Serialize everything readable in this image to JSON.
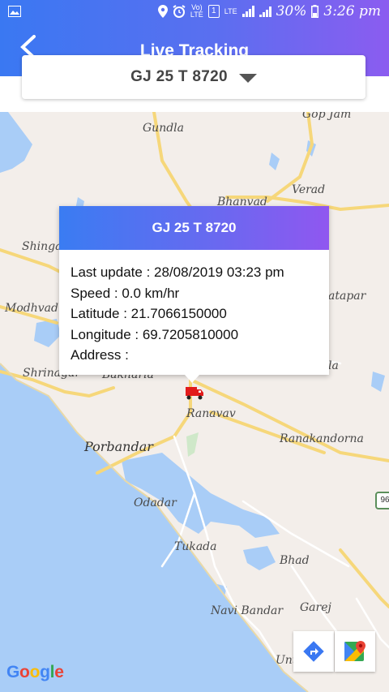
{
  "status_bar": {
    "lte_top": "Vo)",
    "lte_bottom": "LTE",
    "sim": "1",
    "lte2": "LTE",
    "battery": "30%",
    "time": "3:26 pm"
  },
  "header": {
    "title": "Live Tracking",
    "back_icon": "back-arrow-icon"
  },
  "vehicle_select": {
    "selected": "GJ 25 T 8720"
  },
  "popup": {
    "title": "GJ 25 T 8720",
    "last_update": "Last update : 28/08/2019 03:23 pm",
    "speed": "Speed : 0.0 km/hr",
    "latitude": "Latitude : 21.7066150000",
    "longitude": "Longitude : 69.7205810000",
    "address": "Address :"
  },
  "map": {
    "places": {
      "gop_jam": "Gop Jam",
      "gundla": "Gundla",
      "verad": "Verad",
      "bhanvad": "Bhanvad",
      "shingda": "Shinga",
      "modhvad": "Modhvad",
      "atapar": "atapar",
      "shrinagar": "Shrinagar",
      "bakharla": "Bakharla",
      "la": "la",
      "ranavav": "Ranavav",
      "ranakandorna": "Ranakandorna",
      "porbandar": "Porbandar",
      "odadar": "Odadar",
      "tukada": "Tukada",
      "bhad": "Bhad",
      "navi_bandar": "Navi Bandar",
      "garej": "Garej",
      "untada": "Untada",
      "highway_number": "96"
    },
    "branding": "Google",
    "colors": {
      "land": "#f3eeea",
      "water": "#a9cdf7",
      "road": "#f6d77a",
      "accent": "#3a78f2"
    }
  }
}
